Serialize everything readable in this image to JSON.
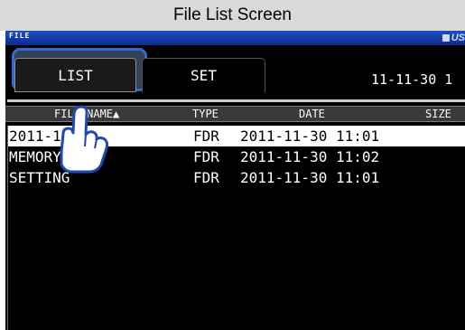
{
  "caption": "File List Screen",
  "topbar": {
    "screen_label": "FILE",
    "usb_text": "US"
  },
  "tabs": [
    {
      "label": "LIST"
    },
    {
      "label": "SET"
    }
  ],
  "datetime": "11-11-30 1",
  "columns": {
    "name": "FILE NAME▲",
    "type": "TYPE",
    "date": "DATE",
    "size": "SIZE"
  },
  "files": [
    {
      "name": "2011-11-30",
      "type": "FDR",
      "date": "2011-11-30 11:01",
      "selected": true
    },
    {
      "name": "MEMORY",
      "type": "FDR",
      "date": "2011-11-30 11:02",
      "selected": false
    },
    {
      "name": "SETTING",
      "type": "FDR",
      "date": "2011-11-30 11:01",
      "selected": false
    }
  ],
  "colors": {
    "title_bar": "#1e4fbf",
    "highlight": "#2f6bd6",
    "screen_bg": "#000000"
  },
  "icons": {
    "pointer": "hand-pointer-icon",
    "usb": "usb-icon"
  }
}
